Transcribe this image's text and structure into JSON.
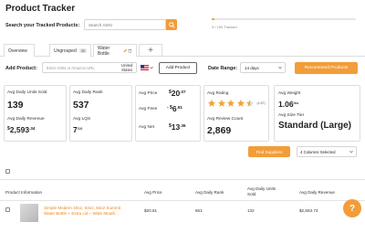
{
  "header": {
    "title": "Product Tracker",
    "search_label": "Search your Tracked Products:",
    "search_placeholder": "Search ASIN",
    "tracked_text": "3 / 150 Tracked",
    "tracked_fraction": 0.02
  },
  "tabs": [
    {
      "label": "Overview"
    },
    {
      "label": "Ungrouped",
      "badge": "30"
    },
    {
      "label": "Water Bottle"
    }
  ],
  "add_row": {
    "label": "Add Product:",
    "input_placeholder": "Enter ASIN or Amazon URL",
    "market_line1": "United",
    "market_line2": "States",
    "add_button": "Add Product",
    "range_label": "Date Range:",
    "range_value": "14 days",
    "recommend_button": "Recommend Products"
  },
  "stats": {
    "avg_daily_units_label": "Avg Daily Units Sold",
    "avg_daily_units_value": "139",
    "avg_daily_revenue_label": "Avg Daily Revenue",
    "avg_daily_revenue_currency": "$",
    "avg_daily_revenue_value": "2,593",
    "avg_daily_revenue_decimal": ".34",
    "avg_daily_rank_label": "Avg Daily Rank",
    "avg_daily_rank_value": "537",
    "avg_lqs_label": "Avg LQS",
    "avg_lqs_value": "7",
    "avg_lqs_unit": "/10",
    "avg_price_label": "Avg Price",
    "avg_price_currency": "$",
    "avg_price_value": "20",
    "avg_price_decimal": ".07",
    "avg_fees_label": "Avg Fees",
    "avg_fees_prefix": "- $",
    "avg_fees_value": "6",
    "avg_fees_decimal": ".91",
    "avg_net_label": "Avg Net",
    "avg_net_currency": "$",
    "avg_net_value": "13",
    "avg_net_decimal": ".36",
    "avg_rating_label": "Avg Rating",
    "avg_rating_stars": 4.5,
    "avg_rating_count": "(4.67)",
    "avg_review_count_label": "Avg Review Count",
    "avg_review_count_value": "2,869",
    "avg_weight_label": "Avg Weight",
    "avg_weight_value": "1.06",
    "avg_weight_unit": "lbs",
    "avg_size_tier_label": "Avg Size Tier",
    "avg_size_tier_value": "Standard (Large)"
  },
  "controls": {
    "find_suppliers": "Find Suppliers",
    "columns_selected": "4 Columns Selected"
  },
  "table": {
    "headers": [
      "Product Information",
      "Avg Price",
      "Avg Daily Rank",
      "Avg Daily Units Sold",
      "Avg Daily Revenue"
    ],
    "rows": [
      {
        "title_line1": "Simple Modern 40oz, 64oz, 64oz Summit",
        "title_line2": "Water Bottle + Extra Lid – Wide Mouth...",
        "price": "$20.81",
        "rank": "661",
        "units": "132",
        "revenue": "$2,563.73"
      }
    ]
  },
  "colors": {
    "accent": "#f29d38",
    "link": "#e8861c",
    "star": "#f2a53a"
  }
}
